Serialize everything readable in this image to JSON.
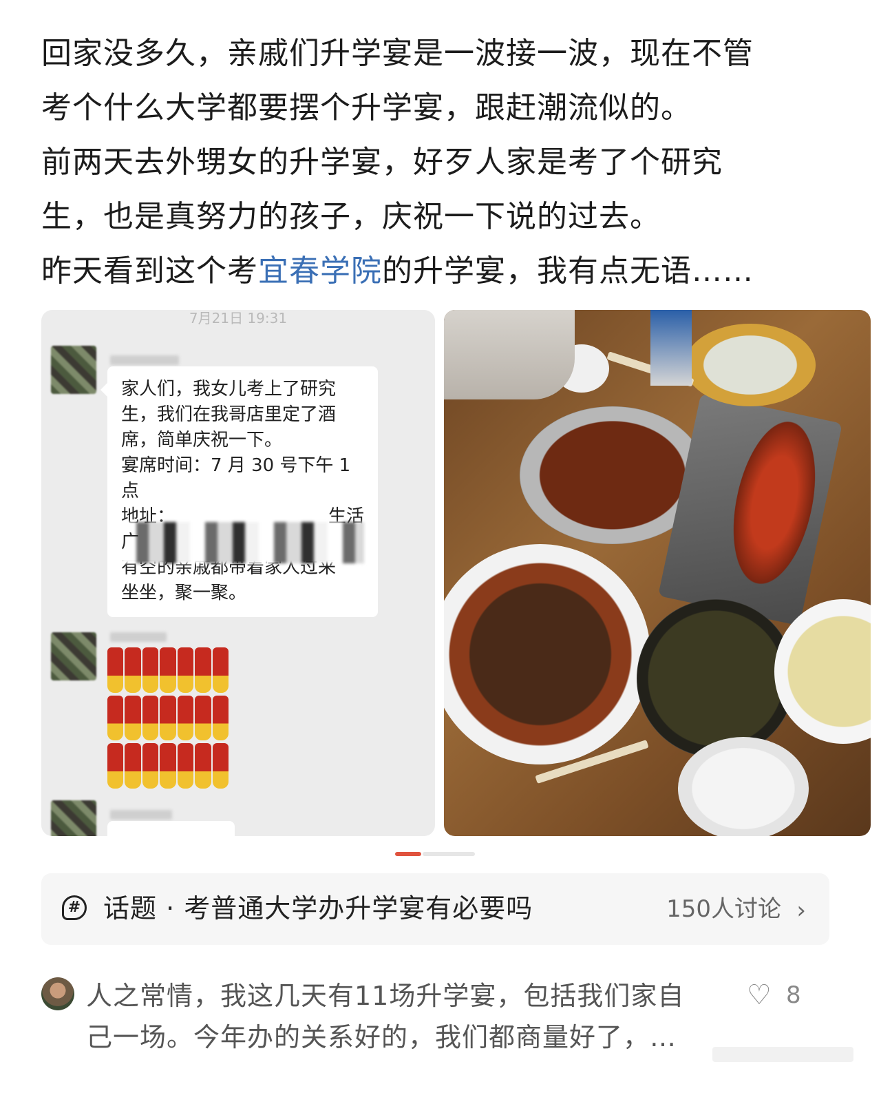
{
  "post": {
    "lines": [
      "回家没多久，亲戚们升学宴是一波接一波，现在不管",
      "考个什么大学都要摆个升学宴，跟赶潮流似的。",
      "前两天去外甥女的升学宴，好歹人家是考了个研究",
      "生，也是真努力的孩子，庆祝一下说的过去。"
    ],
    "last_line_before": "昨天看到这个考",
    "last_line_link": "宜春学院",
    "last_line_after": "的升学宴，我有点无语……"
  },
  "chat": {
    "timestamp": "7月21日 19:31",
    "bubble_lines": [
      "家人们，我女儿考上了研究",
      "生，我们在我哥店里定了酒",
      "席，简单庆祝一下。",
      "宴席时间：7 月 30 号下午 1",
      "点"
    ],
    "address_label": "地址：",
    "address_tail": "生活",
    "address_line2": "广",
    "bubble_lines_after": [
      "有空的亲戚都带着家人过来",
      "坐坐，聚一聚。"
    ]
  },
  "topic": {
    "icon": "hashtag-icon",
    "title": "话题 · 考普通大学办升学宴有必要吗",
    "count": "150人讨论",
    "chevron": "›"
  },
  "comment": {
    "line1": "人之常情，我这几天有11场升学宴，包括我们家自",
    "line2": "己一场。今年办的关系好的，我们都商量好了，…",
    "like_icon": "♡",
    "like_count": "8"
  },
  "colors": {
    "link": "#3a6fb5",
    "pager_active": "#e0533e",
    "pager_inactive": "#e6e6e6"
  }
}
